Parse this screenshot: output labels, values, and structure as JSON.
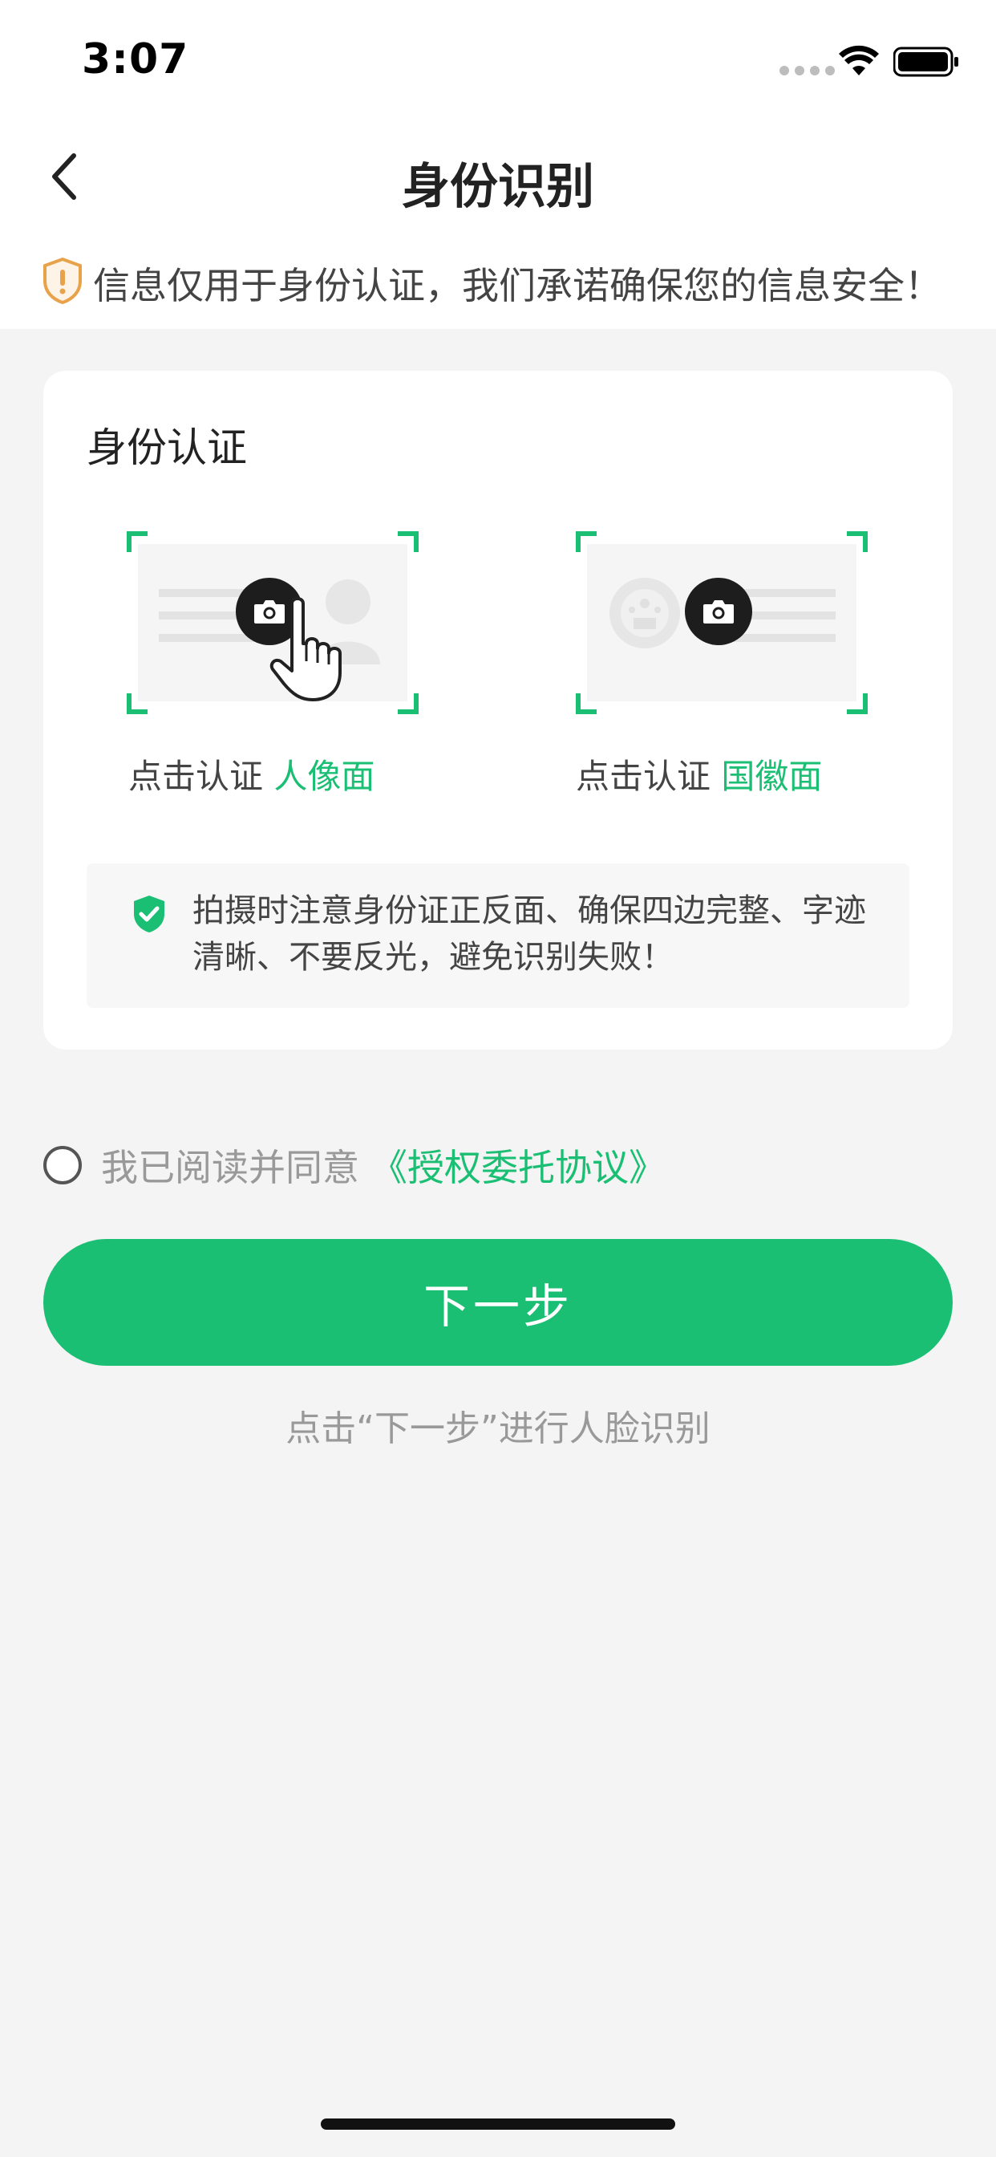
{
  "status_bar": {
    "time": "3:07"
  },
  "nav": {
    "title": "身份识别"
  },
  "notice": {
    "text": "信息仅用于身份认证，我们承诺确保您的信息安全！"
  },
  "card": {
    "title": "身份认证",
    "front": {
      "prefix": "点击认证",
      "highlight": "人像面"
    },
    "back": {
      "prefix": "点击认证",
      "highlight": "国徽面"
    },
    "tips": "拍摄时注意身份证正反面、确保四边完整、字迹清晰、不要反光，避免识别失败！"
  },
  "agreement": {
    "text": "我已阅读并同意",
    "link": "《授权委托协议》",
    "checked": false
  },
  "next_button": {
    "label": "下一步"
  },
  "hint": "点击“下一步”进行人脸识别",
  "colors": {
    "accent": "#1bbf74",
    "warning": "#e8a34a",
    "background": "#f4f4f4"
  }
}
